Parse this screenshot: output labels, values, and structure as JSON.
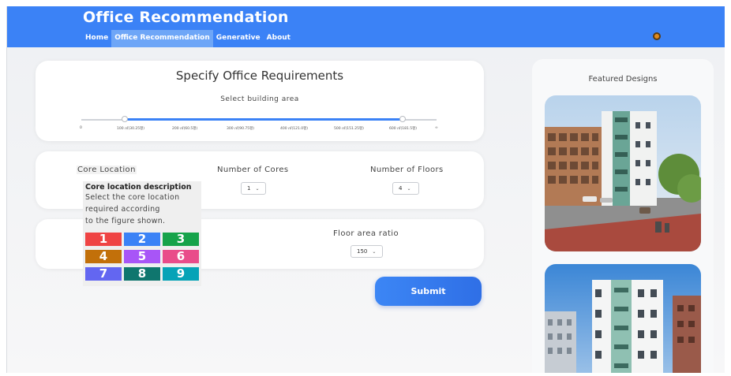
{
  "header": {
    "title": "Office Recommendation",
    "nav": [
      "Home",
      "Office Recommendation",
      "Generative",
      "About"
    ],
    "active_nav": "Office Recommendation"
  },
  "requirements": {
    "title": "Specify Office Requirements",
    "slider_label": "Select building area",
    "ticks": [
      "0",
      "100 ㎡(30.25평)",
      "200 ㎡(60.5평)",
      "300 ㎡(90.75평)",
      "400 ㎡(121.0평)",
      "500 ㎡(151.25평)",
      "600 ㎡(181.5평)",
      "∞"
    ],
    "selected_range": [
      "100 ㎡(30.25평)",
      "600 ㎡(181.5평)"
    ]
  },
  "core": {
    "core_location_label": "Core Location",
    "num_cores_label": "Number of Cores",
    "num_cores_value": "1",
    "num_floors_label": "Number of Floors",
    "num_floors_value": "4"
  },
  "tooltip": {
    "title": "Core location description",
    "lines": [
      "Select the core location",
      "required according",
      "to the figure shown."
    ],
    "cells": [
      {
        "label": "1",
        "color": "#ef4444"
      },
      {
        "label": "2",
        "color": "#3b82f6"
      },
      {
        "label": "3",
        "color": "#16a34a"
      },
      {
        "label": "4",
        "color": "#c2700a"
      },
      {
        "label": "5",
        "color": "#a855f7"
      },
      {
        "label": "6",
        "color": "#e94c8a"
      },
      {
        "label": "7",
        "color": "#6366f1"
      },
      {
        "label": "8",
        "color": "#0f766e"
      },
      {
        "label": "9",
        "color": "#06a3b7"
      }
    ]
  },
  "far": {
    "label": "Floor area ratio",
    "value": "150"
  },
  "submit_label": "Submit",
  "featured": {
    "title": "Featured Designs"
  },
  "colors": {
    "accent": "#3b82f6"
  }
}
